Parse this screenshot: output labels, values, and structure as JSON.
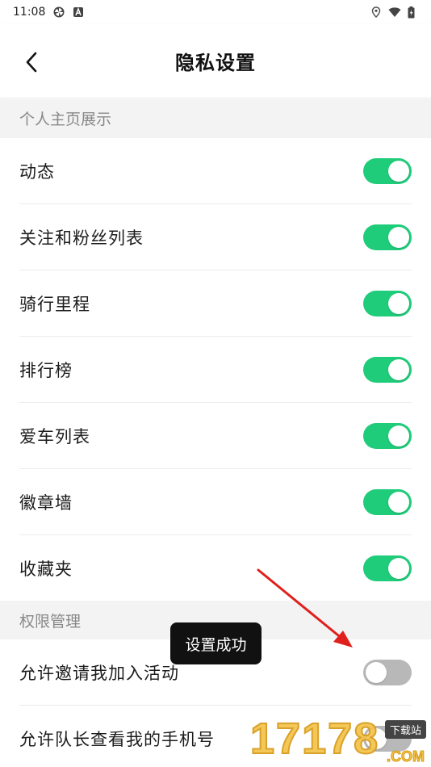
{
  "status_bar": {
    "time": "11:08",
    "left_icons": [
      "pinwheel-icon",
      "a-badge-icon"
    ],
    "right_icons": [
      "location-icon",
      "wifi-icon",
      "battery-icon"
    ]
  },
  "header": {
    "back_icon": "chevron-left-icon",
    "title": "隐私设置"
  },
  "sections": [
    {
      "title": "个人主页展示",
      "items": [
        {
          "label": "动态",
          "enabled": true
        },
        {
          "label": "关注和粉丝列表",
          "enabled": true
        },
        {
          "label": "骑行里程",
          "enabled": true
        },
        {
          "label": "排行榜",
          "enabled": true
        },
        {
          "label": "爱车列表",
          "enabled": true
        },
        {
          "label": "徽章墙",
          "enabled": true
        },
        {
          "label": "收藏夹",
          "enabled": true
        }
      ]
    },
    {
      "title": "权限管理",
      "items": [
        {
          "label": "允许邀请我加入活动",
          "enabled": false
        },
        {
          "label": "允许队长查看我的手机号",
          "enabled": false
        }
      ]
    }
  ],
  "toast": {
    "text": "设置成功"
  },
  "annotation": {
    "type": "red-arrow",
    "color": "#e0201c"
  },
  "watermark": {
    "number": "17178",
    "badge": "下载站",
    "domain": ".COM"
  },
  "colors": {
    "toggle_on": "#1fcc7a",
    "toggle_off": "#b8b8b8",
    "section_bg": "#f3f3f3",
    "section_text": "#888888"
  }
}
